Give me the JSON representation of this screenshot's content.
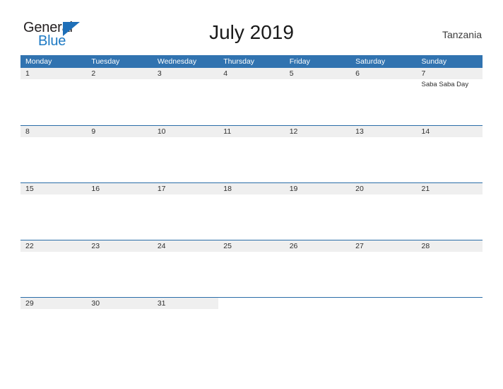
{
  "brand": {
    "name_part1": "General",
    "name_part2": "Blue",
    "triangle_icon": "triangle-flag-icon",
    "color_dark": "#231f20",
    "color_blue": "#1e7ac4"
  },
  "header": {
    "title": "July 2019",
    "country": "Tanzania"
  },
  "theme": {
    "header_blue": "#3173b0",
    "row_line_blue": "#2a6da8",
    "date_strip_gray": "#efefef",
    "text_dark": "#2e2e2e"
  },
  "calendar": {
    "weekdays": [
      "Monday",
      "Tuesday",
      "Wednesday",
      "Thursday",
      "Friday",
      "Saturday",
      "Sunday"
    ],
    "weeks": [
      {
        "days": [
          {
            "number": "1",
            "events": []
          },
          {
            "number": "2",
            "events": []
          },
          {
            "number": "3",
            "events": []
          },
          {
            "number": "4",
            "events": []
          },
          {
            "number": "5",
            "events": []
          },
          {
            "number": "6",
            "events": []
          },
          {
            "number": "7",
            "events": [
              "Saba Saba Day"
            ]
          }
        ]
      },
      {
        "days": [
          {
            "number": "8",
            "events": []
          },
          {
            "number": "9",
            "events": []
          },
          {
            "number": "10",
            "events": []
          },
          {
            "number": "11",
            "events": []
          },
          {
            "number": "12",
            "events": []
          },
          {
            "number": "13",
            "events": []
          },
          {
            "number": "14",
            "events": []
          }
        ]
      },
      {
        "days": [
          {
            "number": "15",
            "events": []
          },
          {
            "number": "16",
            "events": []
          },
          {
            "number": "17",
            "events": []
          },
          {
            "number": "18",
            "events": []
          },
          {
            "number": "19",
            "events": []
          },
          {
            "number": "20",
            "events": []
          },
          {
            "number": "21",
            "events": []
          }
        ]
      },
      {
        "days": [
          {
            "number": "22",
            "events": []
          },
          {
            "number": "23",
            "events": []
          },
          {
            "number": "24",
            "events": []
          },
          {
            "number": "25",
            "events": []
          },
          {
            "number": "26",
            "events": []
          },
          {
            "number": "27",
            "events": []
          },
          {
            "number": "28",
            "events": []
          }
        ]
      },
      {
        "days": [
          {
            "number": "29",
            "events": []
          },
          {
            "number": "30",
            "events": []
          },
          {
            "number": "31",
            "events": []
          },
          {
            "number": "",
            "events": []
          },
          {
            "number": "",
            "events": []
          },
          {
            "number": "",
            "events": []
          },
          {
            "number": "",
            "events": []
          }
        ]
      }
    ]
  }
}
